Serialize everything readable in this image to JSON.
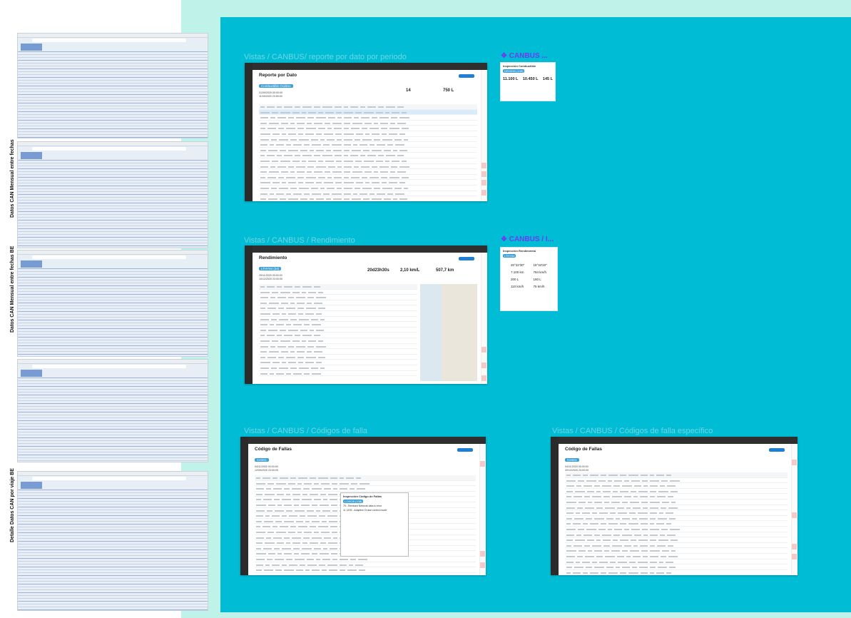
{
  "side_labels": [
    "Datos CAN Mensual entre fechas",
    "Datos CAN Mensual entre fechas BE",
    "Detalle Datos CAN por viaje BE"
  ],
  "frames": {
    "reporte": {
      "title": "Vistas / CANBUS/ reporte por dato por periodo",
      "page_title": "Reporte por Dato",
      "chip": "Combustible Ocidino",
      "dates": [
        "01/09/2020 00:00:00",
        "11/09/2020 23:59:00"
      ],
      "filters": [
        "Centro",
        "Todas las áreas"
      ],
      "stats": [
        {
          "value": "14",
          "label": ""
        },
        {
          "value": "750 L",
          "label": ""
        }
      ]
    },
    "rendimiento": {
      "title": "Vistas / CANBUS / Rendimiento",
      "page_title": "Rendimiento",
      "chip": "LTHY64 (34)",
      "dates": [
        "25/11/2020 00:00:00",
        "10/12/2020 23:00:00"
      ],
      "filters": [
        "Centro",
        "Todas las áreas",
        "Todas las duraciones"
      ],
      "stats": [
        {
          "value": "20d23h30s",
          "label": ""
        },
        {
          "value": "2,10 km/L",
          "label": ""
        },
        {
          "value": "507,7 km",
          "label": ""
        }
      ]
    },
    "codigos": {
      "title": "Vistas / CANBUS / Códigos de falla",
      "page_title": "Código de Fallas",
      "chip": "Centro",
      "dates": [
        "04/11/2020 00:00:00",
        "12/09/2020 23:00:00"
      ],
      "filters": [
        "Todas los patentes",
        "Todas las áreas"
      ],
      "popup": {
        "title": "Inspección Código de Fallas",
        "chip": "LJXK28 (108)",
        "lines": [
          "75 - Remised Network data is error",
          "11 1205 - Adaptive Cruise control mode"
        ]
      }
    },
    "codigos_especifico": {
      "title": "Vistas / CANBUS / Códigos de falla específico",
      "page_title": "Código de Fallas",
      "chip": "Centro",
      "dates": [
        "04/11/2020 00:00:00",
        "20/12/2020 23:00:00"
      ],
      "filters": [
        "DRGE22 (89)",
        "Fallas"
      ]
    }
  },
  "cards": {
    "canbus_1": {
      "heading": "❖ CANBUS ...",
      "title": "Inspección Combustible",
      "chip": "DRGE60 (145)",
      "values": [
        "11.100 L",
        "10.450 L",
        "145 L"
      ]
    },
    "canbus_2": {
      "heading": "❖ CANBUS / I...",
      "title": "Inspección Rendimiento",
      "chip": "LTHY64",
      "values": [
        "20°22'30\"",
        "15°34'20\"",
        "7.100 km",
        "784 km/h",
        "200 L",
        "160 L",
        "110 km/h",
        "75 km/h"
      ]
    }
  },
  "colors": {
    "board": "#00bcd4",
    "background": "#bff3ea",
    "accent": "#6e3cf0",
    "primary": "#1e7fd6"
  }
}
